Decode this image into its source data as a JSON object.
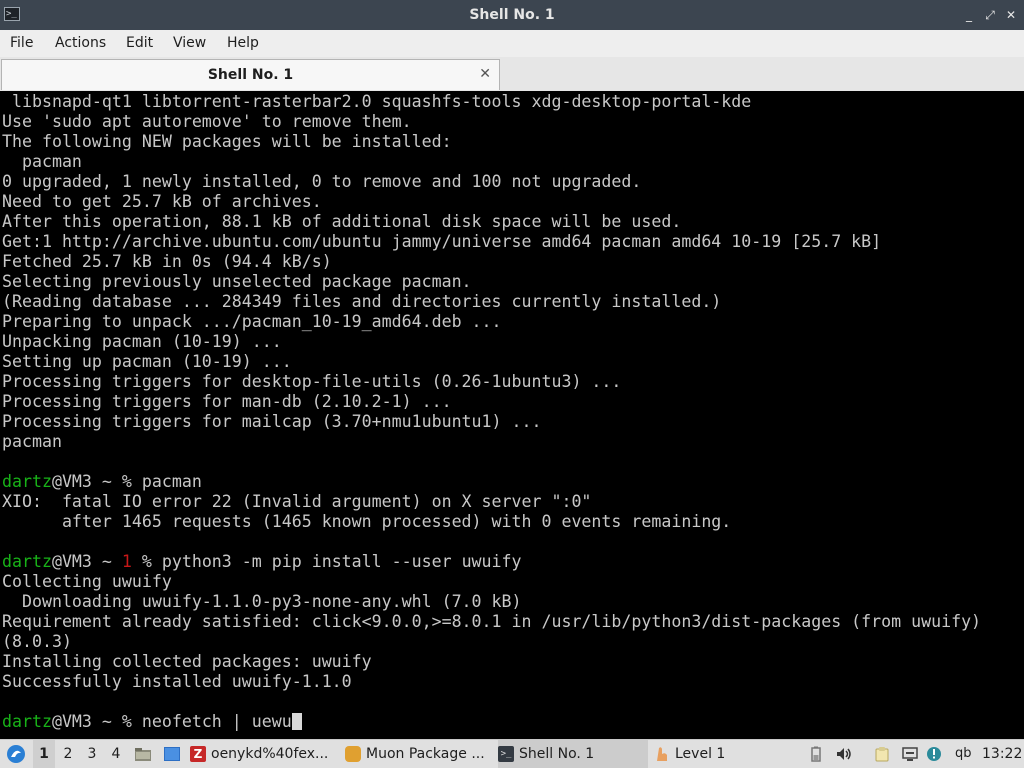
{
  "window": {
    "title": "Shell No. 1",
    "controls": {
      "minimize": "_",
      "restore": "⤢",
      "close": "✕"
    }
  },
  "menubar": {
    "items": [
      "File",
      "Actions",
      "Edit",
      "View",
      "Help"
    ]
  },
  "tabs": [
    {
      "label": "Shell No. 1",
      "close": "✕"
    }
  ],
  "terminal": {
    "lines": [
      " libsnapd-qt1 libtorrent-rasterbar2.0 squashfs-tools xdg-desktop-portal-kde",
      "Use 'sudo apt autoremove' to remove them.",
      "The following NEW packages will be installed:",
      "  pacman",
      "0 upgraded, 1 newly installed, 0 to remove and 100 not upgraded.",
      "Need to get 25.7 kB of archives.",
      "After this operation, 88.1 kB of additional disk space will be used.",
      "Get:1 http://archive.ubuntu.com/ubuntu jammy/universe amd64 pacman amd64 10-19 [25.7 kB]",
      "Fetched 25.7 kB in 0s (94.4 kB/s)",
      "Selecting previously unselected package pacman.",
      "(Reading database ... 284349 files and directories currently installed.)",
      "Preparing to unpack .../pacman_10-19_amd64.deb ...",
      "Unpacking pacman (10-19) ...",
      "Setting up pacman (10-19) ...",
      "Processing triggers for desktop-file-utils (0.26-1ubuntu3) ...",
      "Processing triggers for man-db (2.10.2-1) ...",
      "Processing triggers for mailcap (3.70+nmu1ubuntu1) ...",
      "pacman",
      "",
      {
        "user": "dartz",
        "host": "@VM3 ~ ",
        "status": "",
        "prompt": "% ",
        "cmd": "pacman"
      },
      "XIO:  fatal IO error 22 (Invalid argument) on X server \":0\"",
      "      after 1465 requests (1465 known processed) with 0 events remaining.",
      "",
      {
        "user": "dartz",
        "host": "@VM3 ~ ",
        "status": "1 ",
        "prompt": "% ",
        "cmd": "python3 -m pip install --user uwuify"
      },
      "Collecting uwuify",
      "  Downloading uwuify-1.1.0-py3-none-any.whl (7.0 kB)",
      "Requirement already satisfied: click<9.0.0,>=8.0.1 in /usr/lib/python3/dist-packages (from uwuify)",
      "(8.0.3)",
      "Installing collected packages: uwuify",
      "Successfully installed uwuify-1.1.0",
      "",
      {
        "user": "dartz",
        "host": "@VM3 ~ ",
        "status": "",
        "prompt": "% ",
        "cmd": "neofetch | uewu",
        "cursor": true
      }
    ]
  },
  "taskbar": {
    "workspaces": [
      "1",
      "2",
      "3",
      "4"
    ],
    "active_workspace": "1",
    "tasks": [
      {
        "label": "oenykd%40fex...",
        "icon": "filezilla-icon",
        "color": "#c62828"
      },
      {
        "label": "Muon Package ...",
        "icon": "muon-package-icon",
        "color": "#e0a030"
      },
      {
        "label": "Shell No. 1",
        "icon": "terminal-icon",
        "color": "#333a42",
        "active": true
      },
      {
        "label": "Level 1",
        "icon": "pacman-game-icon",
        "color": "#e8a060"
      }
    ],
    "tray": [
      "battery-icon",
      "volume-icon",
      "clipboard-icon",
      "network-icon",
      "notification-icon"
    ],
    "qb_label": "qb",
    "clock": "13:22"
  }
}
